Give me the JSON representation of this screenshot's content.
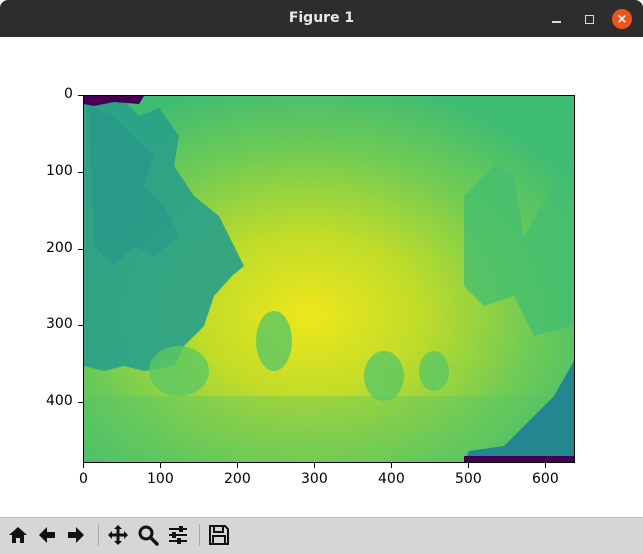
{
  "window": {
    "title": "Figure 1",
    "controls": [
      "minimize-icon",
      "maximize-icon",
      "close-icon"
    ],
    "close_color": "#e9541f"
  },
  "chart_data": {
    "type": "heatmap",
    "title": "",
    "xlabel": "",
    "ylabel": "",
    "xlim": [
      0,
      640
    ],
    "ylim": [
      480,
      0
    ],
    "colormap": "viridis",
    "xticks": [
      "0",
      "100",
      "200",
      "300",
      "400",
      "500",
      "600"
    ],
    "yticks": [
      "0",
      "100",
      "200",
      "300",
      "400"
    ],
    "grid": false,
    "legend": "none"
  },
  "toolbar": {
    "buttons": [
      "home-icon",
      "back-arrow-icon",
      "forward-arrow-icon",
      "pan-icon",
      "zoom-icon",
      "configure-subplots-icon",
      "save-icon"
    ]
  }
}
